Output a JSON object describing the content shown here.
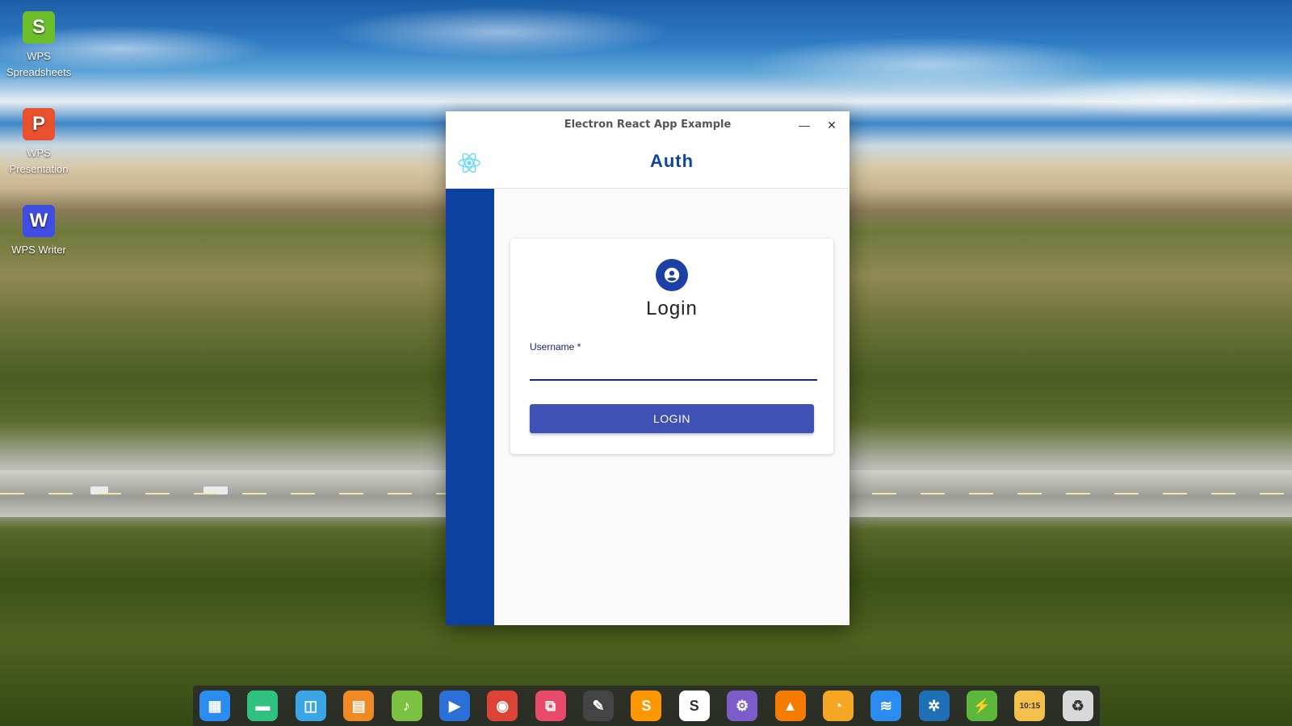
{
  "desktop": {
    "icons": [
      {
        "label": "WPS Spreadsheets",
        "glyph": "S",
        "color": "#6cbf2a"
      },
      {
        "label": "WPS Presentation",
        "glyph": "P",
        "color": "#e8502e"
      },
      {
        "label": "WPS Writer",
        "glyph": "W",
        "color": "#3f4de0"
      }
    ]
  },
  "window": {
    "title": "Electron React App Example",
    "minimize_symbol": "—",
    "close_symbol": "✕",
    "appbar_title": "Auth",
    "accent_color": "#0d3fa1"
  },
  "login_card": {
    "title": "Login",
    "username_label": "Username *",
    "username_value": "",
    "button_label": "LOGIN"
  },
  "dock": {
    "items": [
      {
        "name": "launcher-icon",
        "glyph": "▦",
        "color": "#2b8cf0"
      },
      {
        "name": "terminal-icon",
        "glyph": "▬",
        "color": "#2ec27e"
      },
      {
        "name": "file-manager-icon",
        "glyph": "◫",
        "color": "#3aa6e6"
      },
      {
        "name": "app-store-icon",
        "glyph": "▤",
        "color": "#f08a24"
      },
      {
        "name": "music-icon",
        "glyph": "♪",
        "color": "#7cc242"
      },
      {
        "name": "video-icon",
        "glyph": "▶",
        "color": "#2b6fd8"
      },
      {
        "name": "chrome-icon",
        "glyph": "◉",
        "color": "#db4437"
      },
      {
        "name": "screenshot-icon",
        "glyph": "⧉",
        "color": "#e84a6a"
      },
      {
        "name": "color-picker-icon",
        "glyph": "✎",
        "color": "#444444"
      },
      {
        "name": "sublime-icon",
        "glyph": "S",
        "color": "#ff9800"
      },
      {
        "name": "slack-icon",
        "glyph": "S",
        "color": "#ffffff"
      },
      {
        "name": "settings-tool-icon",
        "glyph": "⚙",
        "color": "#7b5cc9"
      },
      {
        "name": "vlc-icon",
        "glyph": "▲",
        "color": "#f57c00"
      },
      {
        "name": "timer-icon",
        "glyph": "◔",
        "color": "#f5a623"
      },
      {
        "name": "wifi-icon",
        "glyph": "≋",
        "color": "#2b8cf0"
      },
      {
        "name": "system-settings-icon",
        "glyph": "✲",
        "color": "#1f6fb5"
      },
      {
        "name": "power-icon",
        "glyph": "⚡",
        "color": "#5cb83c"
      },
      {
        "name": "clock-icon",
        "glyph": "10:15",
        "color": "#f3c14b"
      },
      {
        "name": "trash-icon",
        "glyph": "♻",
        "color": "#d9d9d9"
      }
    ]
  }
}
